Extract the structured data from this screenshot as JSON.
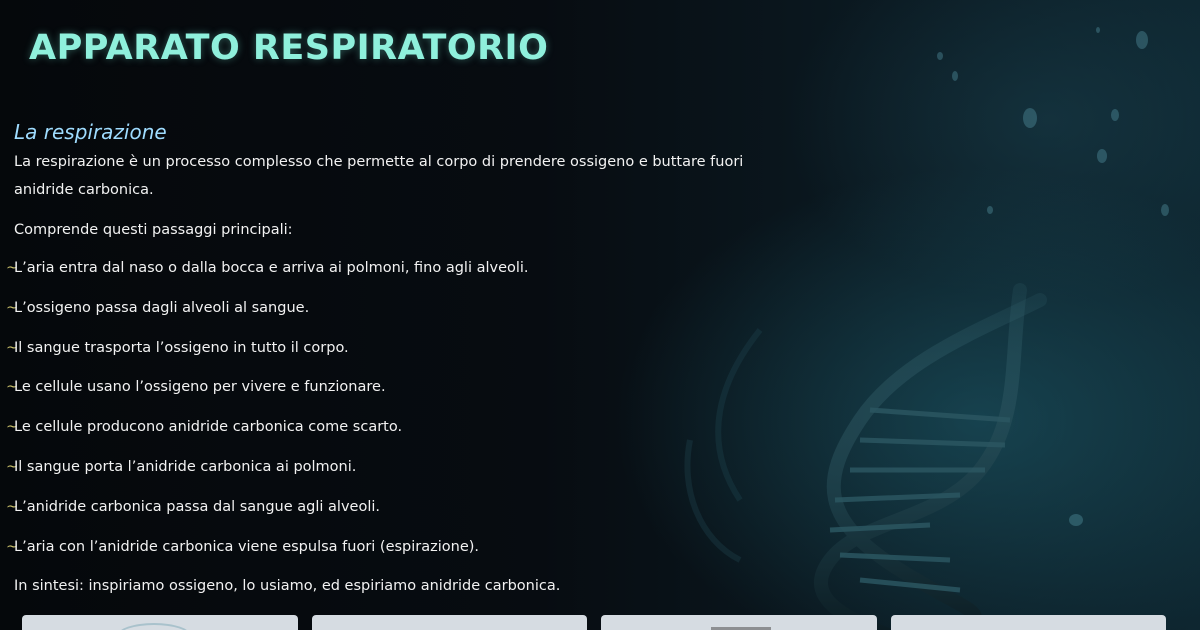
{
  "header": {
    "title": "APPARATO RESPIRATORIO"
  },
  "section": {
    "heading": "La respirazione",
    "intro": "La respirazione è un processo complesso che permette al corpo di prendere ossigeno e buttare fuori anidride carbonica.",
    "lead": "Comprende questi passaggi principali:",
    "bullet_symbol": "~",
    "steps": [
      "L’aria entra dal naso o dalla bocca e arriva ai polmoni, fino agli alveoli.",
      "L’ossigeno passa dagli alveoli al sangue.",
      "Il sangue trasporta l’ossigeno in tutto il corpo.",
      "Le cellule usano l’ossigeno per vivere e funzionare.",
      "Le cellule producono anidride carbonica come scarto.",
      "Il sangue porta l’anidride carbonica ai polmoni.",
      "L’anidride carbonica passa dal sangue agli alveoli.",
      "L’aria con l’anidride carbonica viene espulsa fuori (espirazione)."
    ],
    "summary": "In sintesi: inspiriamo ossigeno, lo usiamo, ed espiriamo anidride carbonica."
  },
  "colors": {
    "title": "#8ff0dc",
    "heading": "#9fdcff",
    "body_text": "#f2f2f2",
    "bullet": "#c9bf6a",
    "background": "#05090d",
    "card": "#d6dce2"
  },
  "cards_count": 4
}
